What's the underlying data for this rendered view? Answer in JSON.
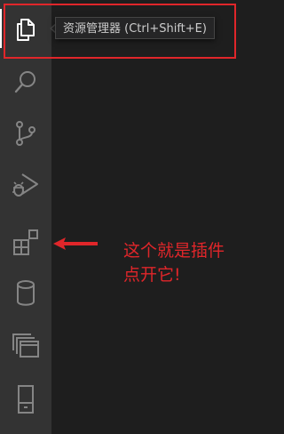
{
  "activity_bar": {
    "items": [
      {
        "name": "explorer",
        "icon": "files-icon",
        "active": true
      },
      {
        "name": "search",
        "icon": "search-icon"
      },
      {
        "name": "source-control",
        "icon": "source-control-icon"
      },
      {
        "name": "run-debug",
        "icon": "run-debug-icon"
      },
      {
        "name": "extensions",
        "icon": "extensions-icon"
      },
      {
        "name": "database",
        "icon": "database-icon"
      },
      {
        "name": "remote-explorer",
        "icon": "windows-icon"
      },
      {
        "name": "device",
        "icon": "device-icon"
      }
    ]
  },
  "tooltip": {
    "text": "资源管理器 (Ctrl+Shift+E)"
  },
  "annotation": {
    "line1": "这个就是插件",
    "line2": "点开它!"
  },
  "colors": {
    "activity_bar_bg": "#333333",
    "editor_bg": "#1e1e1e",
    "icon_active": "#ffffff",
    "icon_inactive": "#858585",
    "annotation_red": "#e0262a"
  }
}
